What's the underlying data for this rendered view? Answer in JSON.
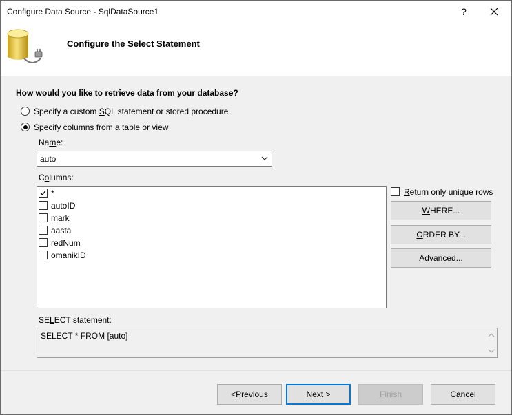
{
  "window": {
    "title": "Configure Data Source - SqlDataSource1",
    "help_label": "?",
    "close_label": "✕"
  },
  "header": {
    "title": "Configure the Select Statement",
    "icon": "database-icon"
  },
  "question": "How would you like to retrieve data from your database?",
  "options": {
    "custom_sql": {
      "pre": "Specify a custom ",
      "key": "S",
      "post": "QL statement or stored procedure",
      "selected": false
    },
    "columns_from_table": {
      "pre": "Specify columns from a ",
      "key": "t",
      "post": "able or view",
      "selected": true
    }
  },
  "name_field": {
    "label_pre": "Na",
    "label_key": "m",
    "label_post": "e:",
    "value": "auto"
  },
  "columns": {
    "label_pre": "C",
    "label_key": "o",
    "label_post": "lumns:",
    "items": [
      {
        "label": "*",
        "checked": true
      },
      {
        "label": "autoID",
        "checked": false
      },
      {
        "label": "mark",
        "checked": false
      },
      {
        "label": "aasta",
        "checked": false
      },
      {
        "label": "redNum",
        "checked": false
      },
      {
        "label": "omanikID",
        "checked": false
      }
    ]
  },
  "unique_rows": {
    "key": "R",
    "post": "eturn only unique rows",
    "checked": false
  },
  "side_buttons": {
    "where": {
      "key": "W",
      "post": "HERE..."
    },
    "order_by": {
      "key": "O",
      "post": "RDER BY..."
    },
    "advanced": {
      "pre": "Ad",
      "key": "v",
      "post": "anced..."
    }
  },
  "select_statement": {
    "label_pre": "SE",
    "label_key": "L",
    "label_post": "ECT statement:",
    "value": "SELECT * FROM [auto]"
  },
  "footer": {
    "previous": {
      "pre": "< ",
      "key": "P",
      "post": "revious"
    },
    "next": {
      "key": "N",
      "post": "ext >"
    },
    "finish": {
      "key": "F",
      "post": "inish",
      "enabled": false
    },
    "cancel": "Cancel"
  },
  "colors": {
    "window_bg": "#f0f0f0",
    "header_bg": "#ffffff",
    "primary_border": "#0078d7",
    "button_bg": "#e1e1e1",
    "disabled_text": "#a0a0a0"
  }
}
